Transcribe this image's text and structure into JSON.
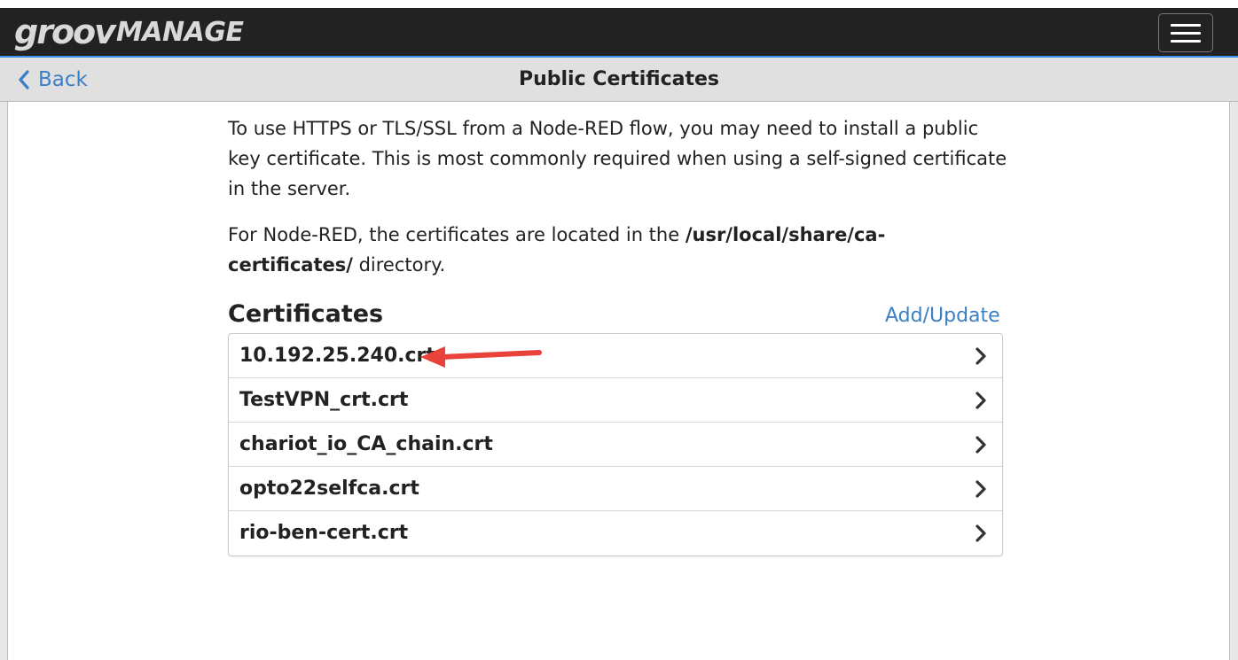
{
  "header": {
    "logo_groov": "groov",
    "logo_manage": "MANAGE",
    "menu_icon": "hamburger-menu-icon"
  },
  "subheader": {
    "back_label": "Back",
    "back_icon": "chevron-left-icon",
    "title": "Public Certificates"
  },
  "intro": {
    "paragraph1": "To use HTTPS or TLS/SSL from a Node-RED flow, you may need to install a public key certificate. This is most commonly required when using a self-signed certificate in the server.",
    "paragraph2_prefix": "For Node-RED, the certificates are located in the ",
    "paragraph2_path": "/usr/local/share/ca-certificates/",
    "paragraph2_suffix": " directory."
  },
  "certificates": {
    "heading": "Certificates",
    "add_update_label": "Add/Update",
    "items": [
      {
        "name": "10.192.25.240.crt"
      },
      {
        "name": "TestVPN_crt.crt"
      },
      {
        "name": "chariot_io_CA_chain.crt"
      },
      {
        "name": "opto22selfca.crt"
      },
      {
        "name": "rio-ben-cert.crt"
      }
    ],
    "item_icon": "chevron-right-icon"
  },
  "annotation": {
    "icon": "red-arrow-annotation-icon",
    "color": "#e8423a"
  },
  "colors": {
    "navbar_bg": "#222222",
    "accent_blue": "#3b7fc4",
    "subheader_bg": "#e0e0e0"
  }
}
